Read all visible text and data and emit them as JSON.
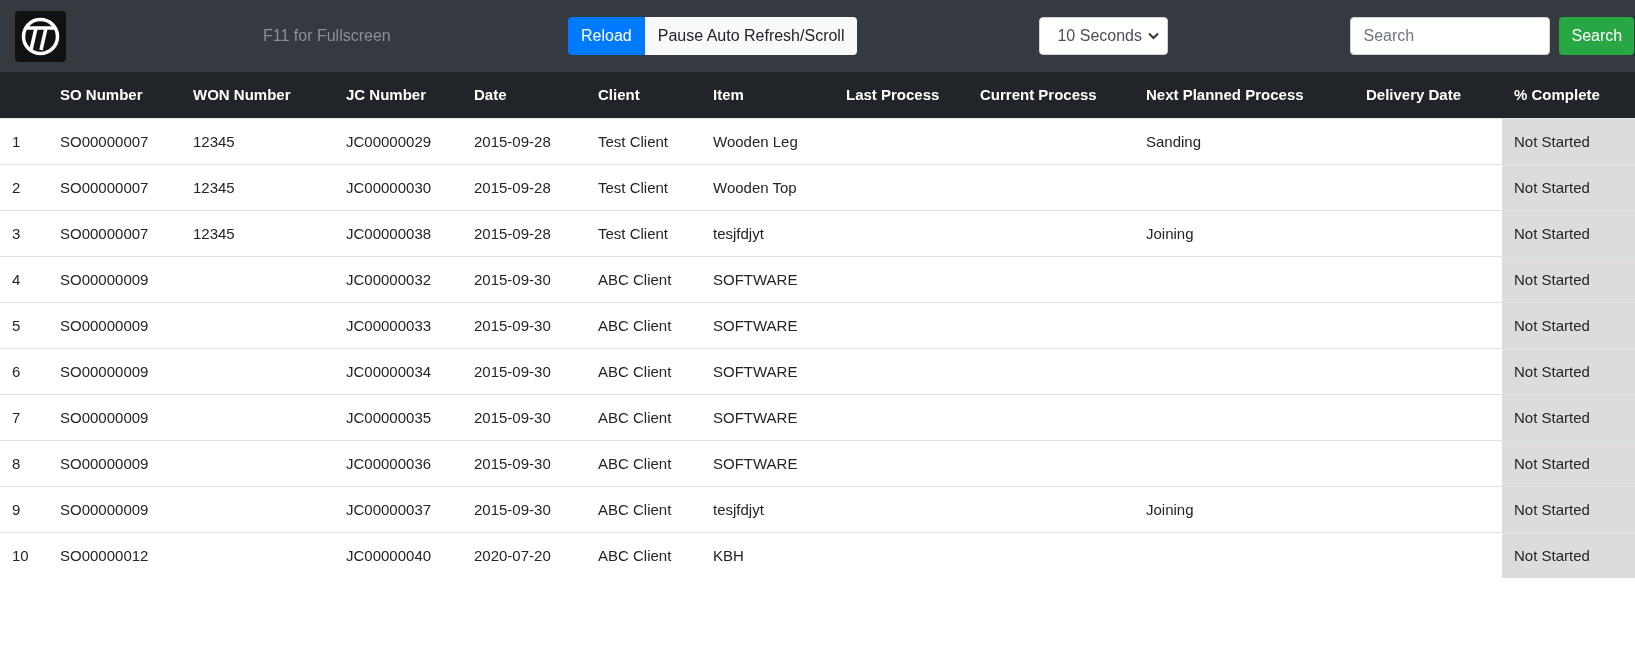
{
  "navbar": {
    "hint": "F11 for Fullscreen",
    "buttons": [
      {
        "label": "Reload",
        "kind": "primary"
      },
      {
        "label": "Pause Auto Refresh/Scroll",
        "kind": "light"
      }
    ],
    "interval": {
      "value": "10 Seconds"
    },
    "search": {
      "placeholder": "Search",
      "button": "Search"
    }
  },
  "table": {
    "columns": [
      "",
      "SO Number",
      "WON Number",
      "JC Number",
      "Date",
      "Client",
      "Item",
      "Last Process",
      "Current Process",
      "Next Planned Process",
      "Delivery Date",
      "% Complete"
    ],
    "rows": [
      [
        "1",
        "SO00000007",
        "12345",
        "JC00000029",
        "2015-09-28",
        "Test Client",
        "Wooden Leg",
        null,
        null,
        "Sanding",
        null,
        "Not Started"
      ],
      [
        "2",
        "SO00000007",
        "12345",
        "JC00000030",
        "2015-09-28",
        "Test Client",
        "Wooden Top",
        null,
        null,
        null,
        null,
        "Not Started"
      ],
      [
        "3",
        "SO00000007",
        "12345",
        "JC00000038",
        "2015-09-28",
        "Test Client",
        "tesjfdjyt",
        null,
        null,
        "Joining",
        null,
        "Not Started"
      ],
      [
        "4",
        "SO00000009",
        null,
        "JC00000032",
        "2015-09-30",
        "ABC Client",
        "SOFTWARE",
        null,
        null,
        null,
        null,
        "Not Started"
      ],
      [
        "5",
        "SO00000009",
        null,
        "JC00000033",
        "2015-09-30",
        "ABC Client",
        "SOFTWARE",
        null,
        null,
        null,
        null,
        "Not Started"
      ],
      [
        "6",
        "SO00000009",
        null,
        "JC00000034",
        "2015-09-30",
        "ABC Client",
        "SOFTWARE",
        null,
        null,
        null,
        null,
        "Not Started"
      ],
      [
        "7",
        "SO00000009",
        null,
        "JC00000035",
        "2015-09-30",
        "ABC Client",
        "SOFTWARE",
        null,
        null,
        null,
        null,
        "Not Started"
      ],
      [
        "8",
        "SO00000009",
        null,
        "JC00000036",
        "2015-09-30",
        "ABC Client",
        "SOFTWARE",
        null,
        null,
        null,
        null,
        "Not Started"
      ],
      [
        "9",
        "SO00000009",
        null,
        "JC00000037",
        "2015-09-30",
        "ABC Client",
        "tesjfdjyt",
        null,
        null,
        "Joining",
        null,
        "Not Started"
      ],
      [
        "10",
        "SO00000012",
        null,
        "JC00000040",
        "2020-07-20",
        "ABC Client",
        "KBH",
        null,
        null,
        null,
        null,
        "Not Started"
      ]
    ]
  }
}
